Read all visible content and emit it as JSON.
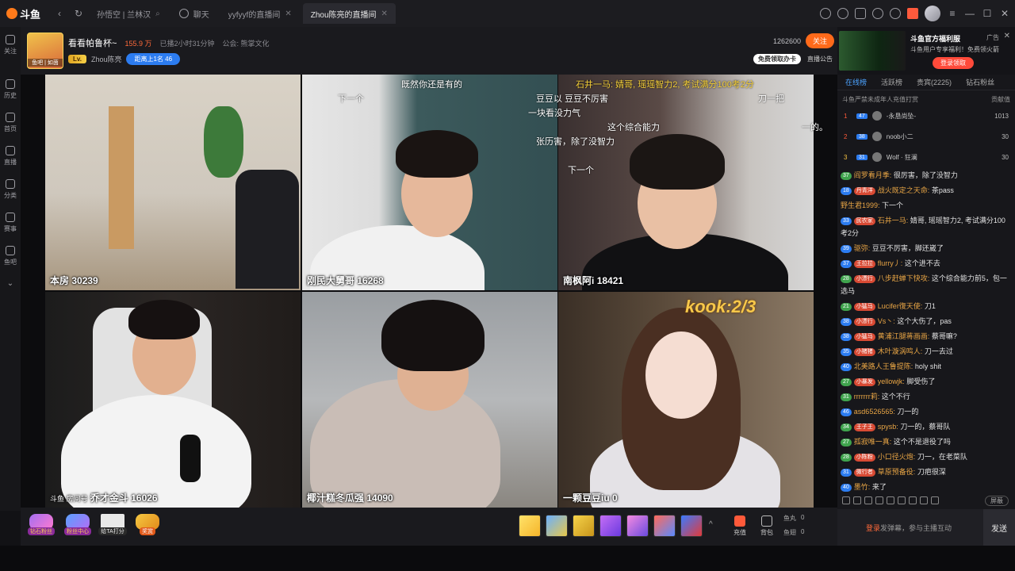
{
  "topbar": {
    "logo_text": "斗鱼",
    "tabs": [
      {
        "label": "孙悟空 | 兰林汉",
        "active": false
      },
      {
        "label": "聊天",
        "active": false
      },
      {
        "label": "yyfyyf的直播间",
        "active": false
      },
      {
        "label": "Zhou陈亮的直播间",
        "active": true
      }
    ],
    "window": {
      "minimize": "—",
      "maximize": "☐",
      "close": "✕"
    }
  },
  "leftnav": {
    "items": [
      {
        "label": "关注"
      },
      {
        "label": "历史"
      },
      {
        "label": "首页"
      },
      {
        "label": "直播"
      },
      {
        "label": "分类"
      },
      {
        "label": "赛事"
      },
      {
        "label": "鱼吧"
      }
    ]
  },
  "room": {
    "title": "看看帕鲁杯~",
    "hot": "155.9 万",
    "duration": "已播2小时31分钟",
    "guild": "公会: 熊掌文化",
    "level_badge": "Lv.",
    "anchor": "Zhou陈亮",
    "rank_pill": "距离上1名 46",
    "fans": "1262600",
    "follow": "关注",
    "free_card": "免费领取办卡",
    "announce": "直播公告",
    "avatar_tag": "鱼吧 | 如茵"
  },
  "ad": {
    "title": "斗鱼官方福利服",
    "tag": "广告",
    "close": "✕",
    "desc": "斗鱼用户专享福利！免费领火箭",
    "button": "登录领取"
  },
  "video": {
    "cells": [
      {
        "name": "本房",
        "score": "30239"
      },
      {
        "name": "刚民大舅哥",
        "score": "16268"
      },
      {
        "name": "南枫阿i",
        "score": "18421"
      },
      {
        "name": "乔才金斗",
        "score": "16026"
      },
      {
        "name": "椰汁糕冬瓜强",
        "score": "14090"
      },
      {
        "name": "一颗豆豆iu",
        "score": "0"
      }
    ],
    "danmu": [
      "既然你还是有的",
      "石井一马: 婧哥, 瑶瑶智力2, 考试满分100考2分",
      "豆豆以 豆豆不厉害",
      "下一个",
      "一块看没力气",
      "这个综合能力",
      "张历害，除了没智力",
      "刀一把",
      "一的。",
      "下一个",
      "kook:2/3",
      "斗鱼 房间号"
    ],
    "sticker_text": "kook:2/3"
  },
  "giftbar": {
    "left_items": [
      {
        "label": "钻石粉丝"
      },
      {
        "label": "粉丝中心"
      },
      {
        "label": "给TA打分"
      },
      {
        "label": "奖赏"
      }
    ],
    "recharge": "充值",
    "backpack": "背包",
    "fish_balls": "鱼丸",
    "fish_balls_value": "0",
    "fish_wings": "鱼翅",
    "fish_wings_value": "0",
    "more": "^"
  },
  "right": {
    "tabs": [
      {
        "label": "在线榜",
        "active": true
      },
      {
        "label": "活跃榜",
        "active": false
      },
      {
        "label": "贵宾(2225)",
        "active": false
      },
      {
        "label": "钻石粉丝",
        "active": false
      }
    ],
    "notice": "斗鱼严禁未成年人充值打赏",
    "notice_right": "贡献值",
    "ranks": [
      {
        "num": "1",
        "badge": "47",
        "name": "-永恳尚坠-",
        "score": "1013"
      },
      {
        "num": "2",
        "badge": "38",
        "name": "noob小二",
        "score": "30"
      },
      {
        "num": "3",
        "badge": "31",
        "name": "Wolf · 狂澜",
        "score": "30"
      }
    ],
    "messages": [
      {
        "lv": "37",
        "lvc": "#3fa34d",
        "fb": "",
        "name": "阎罗看月季:",
        "text": "很厉害，除了没智力"
      },
      {
        "lv": "18",
        "lvc": "#2c7cf0",
        "fb": "丹青洋",
        "name": "战火既定之天命:",
        "text": "茶pass"
      },
      {
        "lv": "",
        "lvc": "#3fa34d",
        "fb": "",
        "name": "野生君1999:",
        "text": "下一个"
      },
      {
        "lv": "33",
        "lvc": "#2c7cf0",
        "fb": "民农家",
        "name": "石井一马:",
        "text": "婧哥, 瑶瑶智力2, 考试满分100考2分"
      },
      {
        "lv": "39",
        "lvc": "#2c7cf0",
        "fb": "",
        "name": "驱弥:",
        "text": "豆豆不厉害，脚还崴了"
      },
      {
        "lv": "37",
        "lvc": "#2c7cf0",
        "fb": "王拉拉",
        "name": "flurry丿:",
        "text": "这个进不去"
      },
      {
        "lv": "28",
        "lvc": "#3fa34d",
        "fb": "小漂行",
        "name": "八步赶蝉下快攻:",
        "text": "这个综合能力前5，包一选马"
      },
      {
        "lv": "21",
        "lvc": "#3fa34d",
        "fb": "小猛马",
        "name": "Lucifer復天使:",
        "text": "刀1"
      },
      {
        "lv": "38",
        "lvc": "#2c7cf0",
        "fb": "小漂行",
        "name": "Vs丶:",
        "text": "这个大伤了，pas"
      },
      {
        "lv": "38",
        "lvc": "#2c7cf0",
        "fb": "小猛马",
        "name": "黄浦江腿蒋画画:",
        "text": "蔡哥嘛?"
      },
      {
        "lv": "35",
        "lvc": "#2c7cf0",
        "fb": "小猪猪",
        "name": "木叶漩涡鸣人:",
        "text": "刀一去过"
      },
      {
        "lv": "40",
        "lvc": "#2c7cf0",
        "fb": "",
        "name": "北美路人王鲁提陈:",
        "text": "holy shit"
      },
      {
        "lv": "27",
        "lvc": "#3fa34d",
        "fb": "小暴发",
        "name": "yellowjk:",
        "text": "脚受伤了"
      },
      {
        "lv": "31",
        "lvc": "#3fa34d",
        "fb": "",
        "name": "rrrrrrr莉:",
        "text": "这个不行"
      },
      {
        "lv": "46",
        "lvc": "#2c7cf0",
        "fb": "",
        "name": "asd6526565:",
        "text": "刀一的"
      },
      {
        "lv": "34",
        "lvc": "#3fa34d",
        "fb": "王子王",
        "name": "spysb:",
        "text": "刀一的，蔡哥队"
      },
      {
        "lv": "27",
        "lvc": "#3fa34d",
        "fb": "",
        "name": "孤寂唯一真:",
        "text": "这个不是退役了吗"
      },
      {
        "lv": "28",
        "lvc": "#3fa34d",
        "fb": "小陈粉",
        "name": "小口径火炮:",
        "text": "刀一，在老菜队"
      },
      {
        "lv": "31",
        "lvc": "#2c7cf0",
        "fb": "微行者",
        "name": "草原预备役:",
        "text": "刀疤很深"
      },
      {
        "lv": "40",
        "lvc": "#2c7cf0",
        "fb": "",
        "name": "墨竹:",
        "text": "来了"
      }
    ],
    "shield": "屏蔽",
    "input_login": "登录",
    "input_hint": "发弹幕，参与主播互动",
    "send": "发送"
  },
  "colors": {
    "accent": "#ff6a1a",
    "blue": "#2c7cf0",
    "bg": "#121215"
  }
}
